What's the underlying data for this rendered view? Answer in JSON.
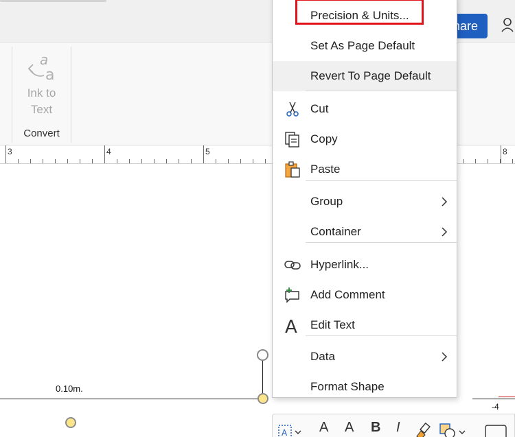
{
  "ribbon": {
    "share_label": "hare",
    "ink_to_text_label": "Ink to\nText",
    "convert_group_label": "Convert"
  },
  "ruler": {
    "numbers": [
      "3",
      "4",
      "5",
      "8"
    ]
  },
  "canvas": {
    "dimension_label": "0.10m.",
    "right_label": "-4"
  },
  "context_menu": {
    "items": [
      {
        "label": "Precision & Units...",
        "icon": "none",
        "submenu": false
      },
      {
        "label": "Set As Page Default",
        "icon": "none",
        "submenu": false
      },
      {
        "label": "Revert To Page Default",
        "icon": "none",
        "submenu": false
      },
      {
        "label": "Cut",
        "icon": "scissors-icon",
        "submenu": false
      },
      {
        "label": "Copy",
        "icon": "copy-icon",
        "submenu": false
      },
      {
        "label": "Paste",
        "icon": "paste-icon",
        "submenu": false
      },
      {
        "label": "Group",
        "icon": "none",
        "submenu": true
      },
      {
        "label": "Container",
        "icon": "none",
        "submenu": true
      },
      {
        "label": "Hyperlink...",
        "icon": "link-icon",
        "submenu": false
      },
      {
        "label": "Add Comment",
        "icon": "comment-icon",
        "submenu": false
      },
      {
        "label": "Edit Text",
        "icon": "text-a-icon",
        "submenu": false
      },
      {
        "label": "Data",
        "icon": "none",
        "submenu": true
      },
      {
        "label": "Format Shape",
        "icon": "none",
        "submenu": false
      }
    ],
    "highlighted": "Revert To Page Default",
    "annotated": "Precision & Units..."
  },
  "mini_toolbar": {
    "labels": [
      "A",
      "A",
      "A",
      "B",
      "I"
    ]
  },
  "colors": {
    "share_button": "#1f5fbf",
    "annotation_box": "#e2121a",
    "handle_yellow": "#fde58c"
  }
}
